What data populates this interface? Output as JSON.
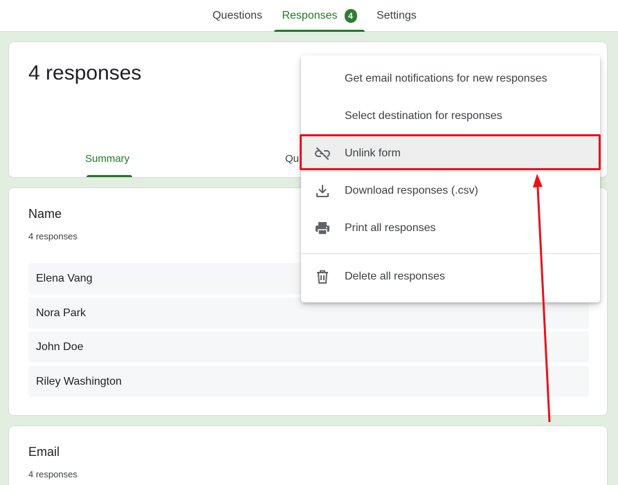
{
  "topnav": {
    "tabs": [
      {
        "label": "Questions"
      },
      {
        "label": "Responses",
        "badge": "4",
        "active": true
      },
      {
        "label": "Settings"
      }
    ]
  },
  "summary_card": {
    "title": "4 responses",
    "subtabs": [
      {
        "label": "Summary",
        "active": true
      },
      {
        "label": "Qu"
      }
    ]
  },
  "name_card": {
    "question": "Name",
    "count": "4 responses",
    "answers": [
      "Elena Vang",
      "Nora Park",
      "John Doe",
      "Riley Washington"
    ]
  },
  "email_card": {
    "question": "Email",
    "count": "4 responses"
  },
  "menu": {
    "items": [
      {
        "label": "Get email notifications for new responses",
        "icon": "none"
      },
      {
        "label": "Select destination for responses",
        "icon": "none"
      },
      {
        "label": "Unlink form",
        "icon": "link-off-icon",
        "highlighted": true
      },
      {
        "label": "Download responses (.csv)",
        "icon": "download-icon"
      },
      {
        "label": "Print all responses",
        "icon": "printer-icon"
      },
      {
        "label": "Delete all responses",
        "icon": "trash-icon"
      }
    ]
  },
  "colors": {
    "accent_green": "#1e7a26",
    "badge_green": "#2e7d32",
    "annotation_red": "#e8121b",
    "page_bg": "#e2eee0"
  }
}
